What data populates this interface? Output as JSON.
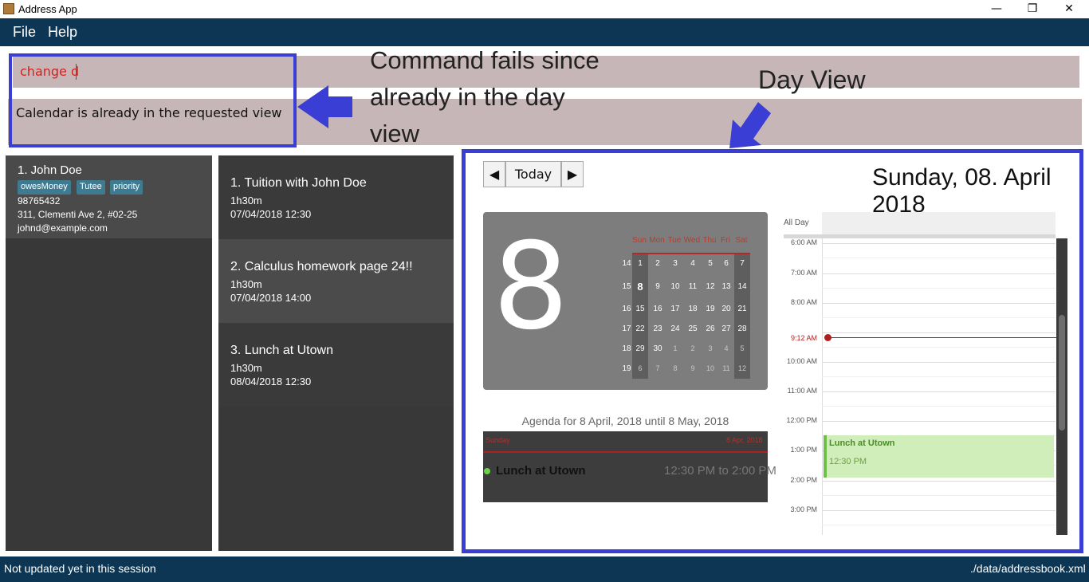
{
  "window": {
    "title": "Address App",
    "minimize": "—",
    "restore": "❐",
    "close": "✕",
    "icon": "app-book-icon"
  },
  "menu": {
    "file": "File",
    "help": "Help"
  },
  "command": {
    "value": "change d",
    "result": "Calendar is already in the requested view"
  },
  "annotations": {
    "command_fails_lines": [
      "Command fails since",
      "already in the day",
      "view"
    ],
    "day_view": "Day View",
    "arrow_color": "#3b3ed4"
  },
  "person": {
    "name": "1.  John Doe",
    "tags": [
      "owesMoney",
      "Tutee",
      "priority"
    ],
    "phone": "98765432",
    "address": "311, Clementi Ave 2, #02-25",
    "email": "johnd@example.com"
  },
  "tasks": [
    {
      "title": "1.  Tuition with John Doe",
      "duration": "1h30m",
      "datetime": "07/04/2018 12:30"
    },
    {
      "title": "2.  Calculus homework page 24!!",
      "duration": "1h30m",
      "datetime": "07/04/2018 14:00"
    },
    {
      "title": "3.  Lunch at Utown",
      "duration": "1h30m",
      "datetime": "08/04/2018 12:30"
    }
  ],
  "calendar": {
    "prev_icon": "◀",
    "today_label": "Today",
    "next_icon": "▶",
    "date_title": "Sunday, 08. April 2018",
    "big_day": "8",
    "weekdays": [
      "Sun",
      "Mon",
      "Tue",
      "Wed",
      "Thu",
      "Fri",
      "Sat"
    ],
    "weeks": [
      {
        "num": "14",
        "days": [
          "1",
          "2",
          "3",
          "4",
          "5",
          "6",
          "7"
        ],
        "dim": [
          false,
          false,
          false,
          false,
          false,
          false,
          false
        ]
      },
      {
        "num": "15",
        "days": [
          "8",
          "9",
          "10",
          "11",
          "12",
          "13",
          "14"
        ],
        "dim": [
          false,
          false,
          false,
          false,
          false,
          false,
          false
        ]
      },
      {
        "num": "16",
        "days": [
          "15",
          "16",
          "17",
          "18",
          "19",
          "20",
          "21"
        ],
        "dim": [
          false,
          false,
          false,
          false,
          false,
          false,
          false
        ]
      },
      {
        "num": "17",
        "days": [
          "22",
          "23",
          "24",
          "25",
          "26",
          "27",
          "28"
        ],
        "dim": [
          false,
          false,
          false,
          false,
          false,
          false,
          false
        ]
      },
      {
        "num": "18",
        "days": [
          "29",
          "30",
          "1",
          "2",
          "3",
          "4",
          "5"
        ],
        "dim": [
          false,
          false,
          true,
          true,
          true,
          true,
          true
        ]
      },
      {
        "num": "19",
        "days": [
          "6",
          "7",
          "8",
          "9",
          "10",
          "11",
          "12"
        ],
        "dim": [
          true,
          true,
          true,
          true,
          true,
          true,
          true
        ]
      }
    ],
    "agenda": {
      "title": "Agenda for 8 April, 2018 until 8 May, 2018",
      "day_name": "Sunday",
      "day_date": "8 Apr, 2018",
      "event": "Lunch at Utown",
      "event_time": "12:30 PM to 2:00 PM"
    },
    "all_day": "All Day",
    "hours": [
      "6:00 AM",
      "7:00 AM",
      "8:00 AM",
      "9:12 AM",
      "10:00 AM",
      "11:00 AM",
      "12:00 PM",
      "1:00 PM",
      "2:00 PM",
      "3:00 PM"
    ],
    "event": {
      "title": "Lunch at Utown",
      "time": "12:30 PM"
    }
  },
  "status": {
    "left": "Not updated yet in this session",
    "right": "./data/addressbook.xml"
  },
  "colors": {
    "accent": "#3b3ed4",
    "menu_bg": "#0d3654",
    "command_bg": "#c6b6b7",
    "panel_bg": "#383838",
    "tag": "#3e7b91",
    "event": "#cfeeb9",
    "now": "#b01f1f"
  }
}
